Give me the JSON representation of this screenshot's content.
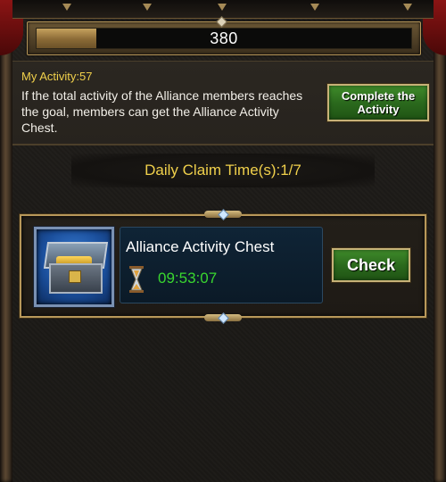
{
  "progress": {
    "value_text": "380",
    "fill_fraction": 0.16
  },
  "activity": {
    "my_activity": "My Activity:57",
    "description": "If the total activity of the Alliance members reaches the goal, members can get the Alliance Activity Chest.",
    "complete_button": "Complete the Activity"
  },
  "daily_claim": "Daily Claim Time(s):1/7",
  "chest_card": {
    "name": "Alliance Activity Chest",
    "timer": "09:53:07",
    "check_button": "Check",
    "icon": "treasure-chest-icon"
  },
  "colors": {
    "accent_yellow": "#f0d04b",
    "timer_green": "#39d62f",
    "button_green": "#2b6a1d",
    "frame_gold": "#b8985a"
  }
}
